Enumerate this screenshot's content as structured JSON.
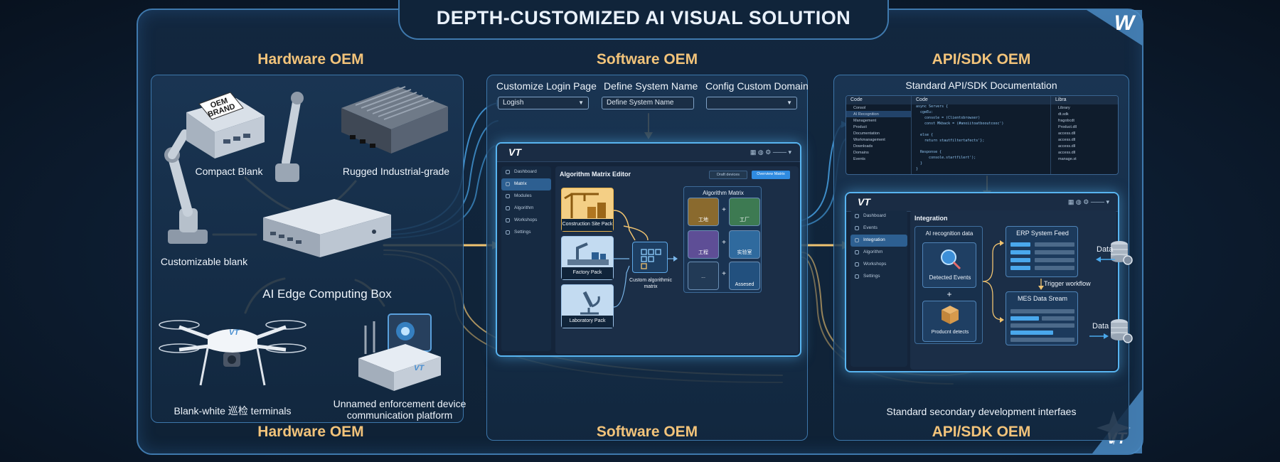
{
  "title": "DEPTH-CUSTOMIZED AI VISUAL SOLUTION",
  "corner_logo_top": "W",
  "corner_logo_bottom": "VT",
  "hardware": {
    "heading": "Hardware OEM",
    "footer": "Hardware OEM",
    "labels": {
      "compact": "Compact Blank",
      "rugged": "Rugged Industrial-grade",
      "customizable": "Customizable blank",
      "edge_box": "AI Edge Computing Box",
      "drone": "Blank-white 巡检 terminals",
      "enforcement_line1": "Unnamed enforcement device",
      "enforcement_line2": "communication platform"
    },
    "oem_brand_sticker": "OEM BRAND",
    "drone_mark": "VT",
    "device_mark": "VT"
  },
  "software": {
    "heading": "Software OEM",
    "footer": "Software OEM",
    "fields": [
      {
        "label": "Customize Login Page",
        "value": "Logish",
        "dropdown": true
      },
      {
        "label": "Define System Name",
        "value": "Define System Name",
        "dropdown": false
      },
      {
        "label": "Config Custom Domain",
        "value": "",
        "dropdown": true
      }
    ],
    "app": {
      "logo": "VT",
      "sidebar": [
        "Dashboard",
        "Matrix",
        "Modules",
        "Algorithm",
        "Workshops",
        "Settings"
      ],
      "active_index": 1,
      "main_title": "Algorithm Matrix Editor",
      "header_buttons": [
        "Draft devices",
        "Overview Matrix"
      ],
      "packs": [
        "Construction Site Pack",
        "Factory Pack",
        "Laboratory Pack"
      ],
      "center_label": "Custom algorithmic matrix",
      "matrix_title": "Algorithm Matrix",
      "matrix_tiles": [
        "工地",
        "工厂",
        "工程",
        "实验室",
        "...",
        "Assesed"
      ],
      "plus": "+"
    }
  },
  "api": {
    "heading": "API/SDK OEM",
    "footer": "API/SDK OEM",
    "doc_title": "Standard API/SDK Documentation",
    "code_headers": [
      "Code",
      "Code",
      "Libra"
    ],
    "tree": [
      "Consol",
      "AI Recognition",
      "Management",
      "Product",
      "Documentation",
      "Workmanagement",
      "Downloads",
      "Domains",
      "Events"
    ],
    "code_lines": [
      "async Servers {",
      "  cgeEu:",
      "    console = (Clientsbrowser)",
      "    const Mkback = (#anoiitoatbooutcooc')",
      "",
      "  else {",
      "    return stautfiltertafects'};",
      "",
      "  Response {",
      "      console.startfilert');",
      "  }",
      "}"
    ],
    "libs": [
      "Library",
      "dt.sdk",
      "fragobcdt",
      "Product.dll",
      "access.dll",
      "access.dll",
      "access.dll",
      "access.dll",
      "manage.st"
    ],
    "app": {
      "logo": "VT",
      "sidebar": [
        "Dashboard",
        "Events",
        "Integration",
        "Algorithm",
        "Workshops",
        "Settings"
      ],
      "active_index": 2,
      "main_title": "Integration",
      "ai_box_title": "AI recognition data",
      "detected": "Detected Events",
      "plus": "+",
      "product": "Producnt detects",
      "erp": "ERP System Feed",
      "trigger": "Trigger workflow",
      "mes": "MES Data Sream",
      "data_top": "Data",
      "data_bottom": "Data"
    },
    "footnote": "Standard secondary development interfaes"
  },
  "colors": {
    "border": "#3f79ad",
    "heading": "#f2c37a",
    "glow": "#58b4f0",
    "gold_flow": "#f0c370",
    "blue_flow": "#4aa8ec"
  }
}
